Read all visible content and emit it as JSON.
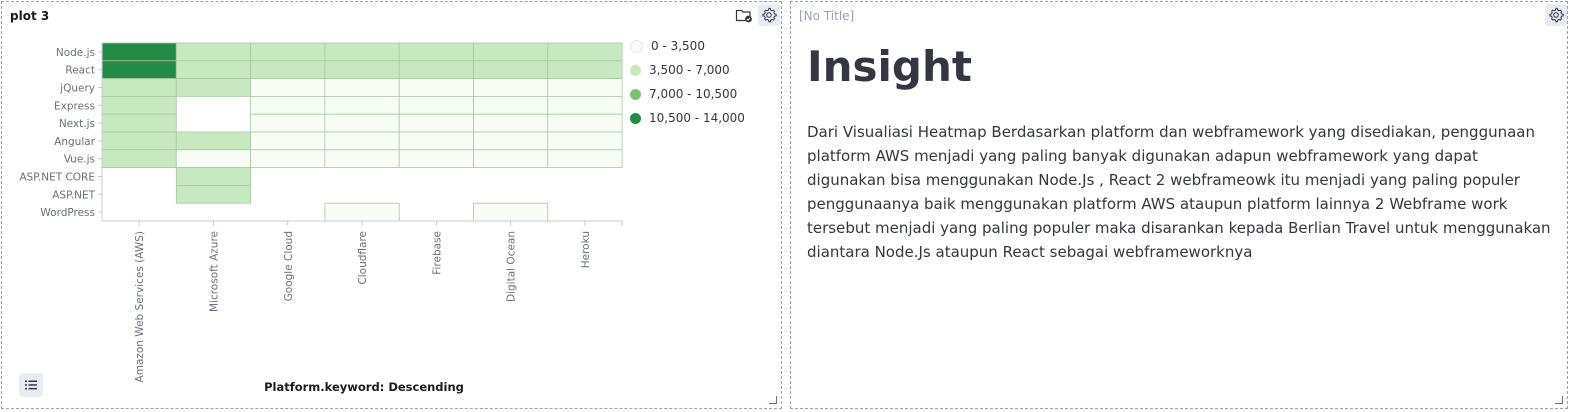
{
  "panel_left": {
    "title": "plot 3",
    "x_axis_title": "Platform.keyword: Descending",
    "icons": {
      "filter": "folder-check-icon",
      "settings": "gear-icon",
      "legend": "list-icon"
    }
  },
  "panel_right": {
    "title": "[No Title]",
    "heading": "Insight",
    "body": "Dari Visualiasi Heatmap Berdasarkan platform dan webframework yang disediakan, penggunaan platform AWS menjadi yang paling banyak digunakan adapun webframework yang dapat digunakan bisa menggunakan Node.Js , React 2 webframeowk itu menjadi yang paling populer penggunaanya baik menggunakan platform AWS ataupun platform lainnya 2 Webframe work tersebut menjadi yang paling populer maka disarankan kepada Berlian Travel untuk menggunakan diantara Node.Js ataupun React sebagai webframeworknya"
  },
  "legend": [
    {
      "label": "0 - 3,500",
      "color": "#f7fcf5"
    },
    {
      "label": "3,500 - 7,000",
      "color": "#c7e9c0"
    },
    {
      "label": "7,000 - 10,500",
      "color": "#74c476"
    },
    {
      "label": "10,500 - 14,000",
      "color": "#238b45"
    }
  ],
  "chart_data": {
    "type": "heatmap",
    "x_categories": [
      "Amazon Web Services (AWS)",
      "Microsoft Azure",
      "Google Cloud",
      "Cloudflare",
      "Firebase",
      "Digital Ocean",
      "Heroku"
    ],
    "y_categories": [
      "Node.js",
      "React",
      "jQuery",
      "Express",
      "Next.js",
      "Angular",
      "Vue.js",
      "ASP.NET CORE",
      "ASP.NET",
      "WordPress"
    ],
    "bins": [
      [
        0,
        3500
      ],
      [
        3500,
        7000
      ],
      [
        7000,
        10500
      ],
      [
        10500,
        14000
      ]
    ],
    "bin_index": [
      [
        3,
        1,
        1,
        1,
        1,
        1,
        1
      ],
      [
        3,
        1,
        1,
        1,
        1,
        1,
        1
      ],
      [
        1,
        1,
        0,
        0,
        0,
        0,
        0
      ],
      [
        1,
        null,
        0,
        0,
        0,
        0,
        0
      ],
      [
        1,
        null,
        0,
        0,
        0,
        0,
        0
      ],
      [
        1,
        1,
        0,
        0,
        0,
        0,
        0
      ],
      [
        1,
        0,
        0,
        0,
        0,
        0,
        0
      ],
      [
        null,
        1,
        null,
        null,
        null,
        null,
        null
      ],
      [
        null,
        1,
        null,
        null,
        null,
        null,
        null
      ],
      [
        null,
        null,
        null,
        0,
        null,
        0,
        null
      ]
    ],
    "xlabel": "Platform.keyword: Descending",
    "ylabel": "",
    "legend_position": "right"
  }
}
